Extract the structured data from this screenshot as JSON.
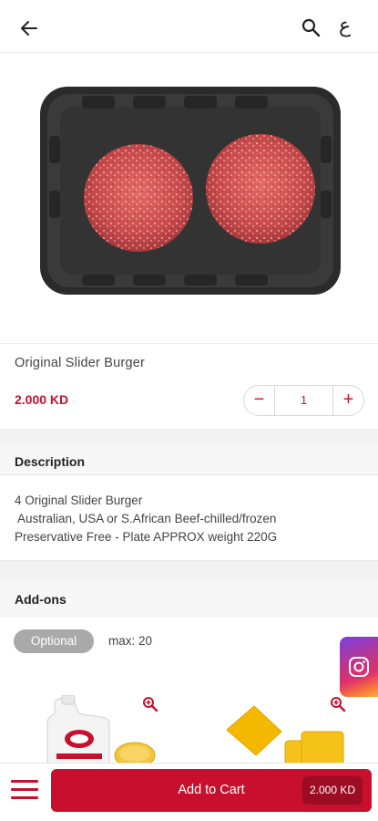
{
  "header": {
    "back_icon": "arrow-left-icon",
    "search_icon": "search-icon",
    "language_toggle": "ع"
  },
  "product": {
    "image": "slider-burger-patties-tray",
    "name": "Original Slider Burger",
    "price": "2.000 KD",
    "quantity": "1",
    "minus": "−",
    "plus": "+"
  },
  "description": {
    "title": "Description",
    "lines": [
      "4 Original Slider Burger",
      " Australian, USA or S.African Beef-chilled/frozen",
      "Preservative Free - Plate APPROX weight 220G"
    ]
  },
  "addons": {
    "title": "Add-ons",
    "badge": "Optional",
    "max": "max: 20",
    "items": [
      {
        "image": "burger-sauce-pouch",
        "zoom_icon": "zoom-in-icon"
      },
      {
        "image": "cheese-slices",
        "zoom_icon": "zoom-in-icon"
      }
    ]
  },
  "social": {
    "icon": "instagram-icon"
  },
  "footer": {
    "menu_icon": "hamburger-menu-icon",
    "add_to_cart": "Add to Cart",
    "total": "2.000 KD"
  },
  "colors": {
    "accent": "#c8102e",
    "background": "#ffffff",
    "section_bg": "#f2f2f2"
  }
}
